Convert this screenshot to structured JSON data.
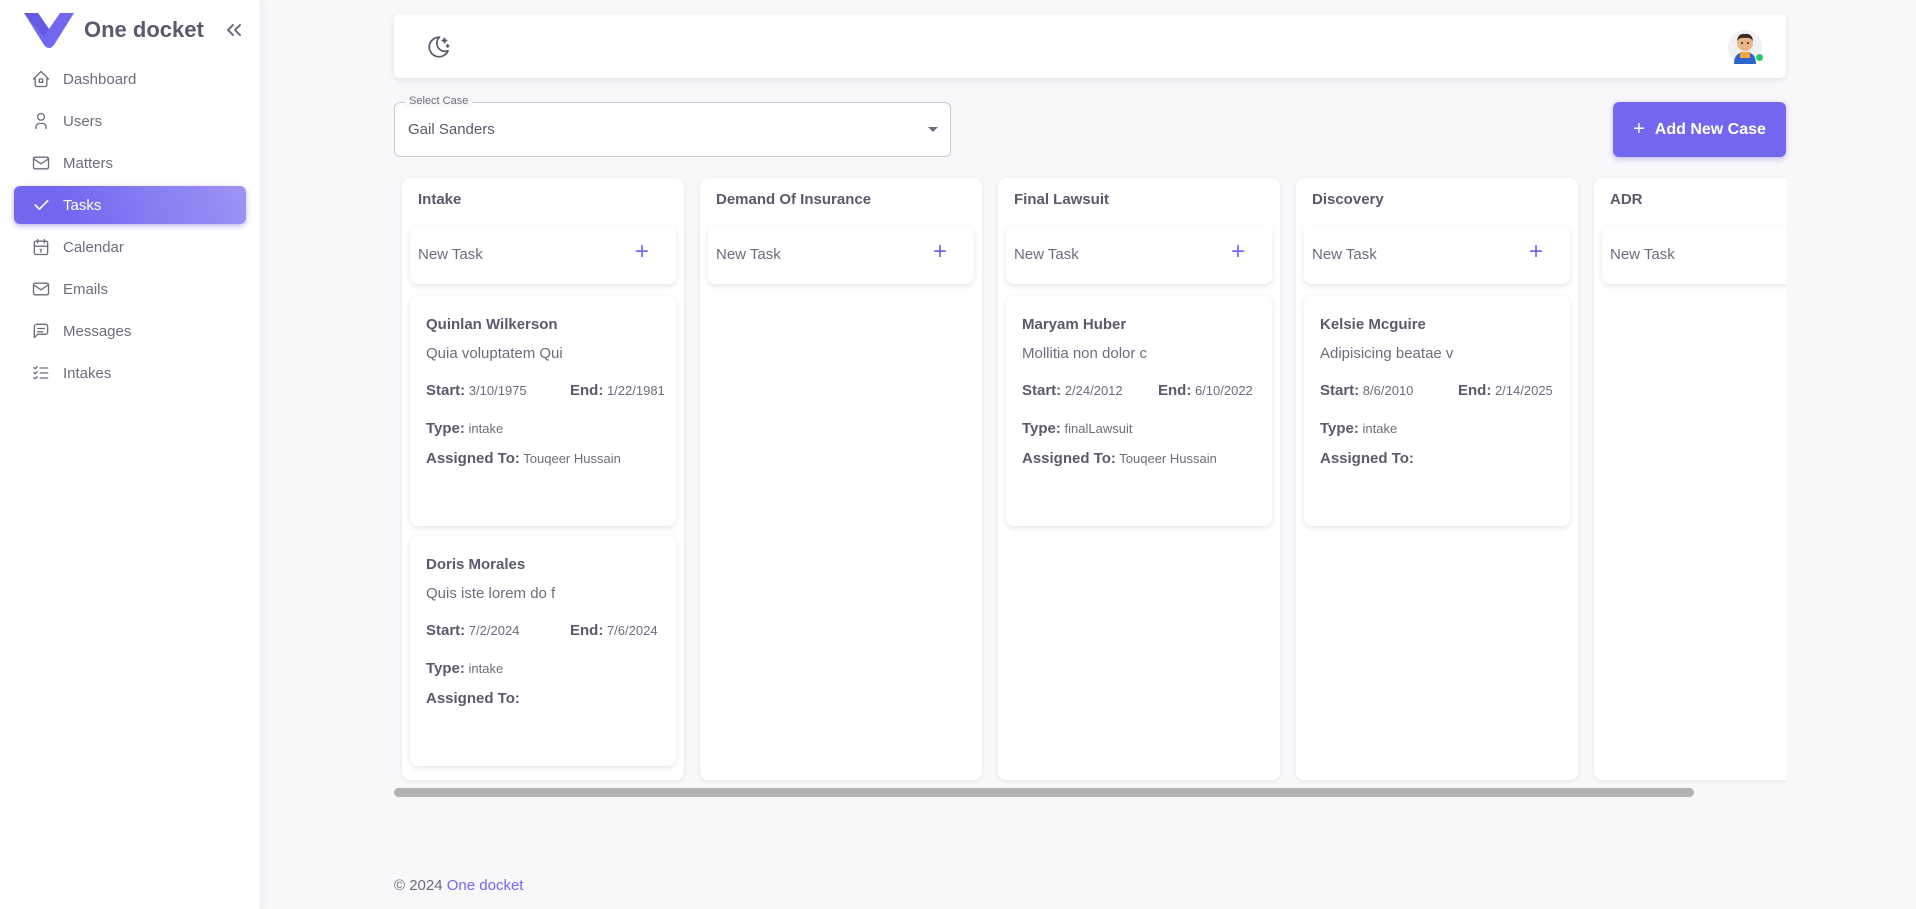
{
  "brand": {
    "name": "One docket",
    "color": "#7367f0"
  },
  "sidebar": {
    "items": [
      {
        "label": "Dashboard",
        "icon": "home-icon",
        "active": false
      },
      {
        "label": "Users",
        "icon": "user-icon",
        "active": false
      },
      {
        "label": "Matters",
        "icon": "mail-icon",
        "active": false
      },
      {
        "label": "Tasks",
        "icon": "check-icon",
        "active": true
      },
      {
        "label": "Calendar",
        "icon": "calendar-icon",
        "active": false
      },
      {
        "label": "Emails",
        "icon": "mail-icon",
        "active": false
      },
      {
        "label": "Messages",
        "icon": "message-icon",
        "active": false
      },
      {
        "label": "Intakes",
        "icon": "list-check-icon",
        "active": false
      }
    ]
  },
  "select_case": {
    "label": "Select Case",
    "value": "Gail Sanders"
  },
  "add_case_button": {
    "label": "Add New Case"
  },
  "new_task_label": "New Task",
  "columns": [
    {
      "title": "Intake",
      "tasks": [
        {
          "name": "Quinlan Wilkerson",
          "desc": "Quia voluptatem Qui",
          "start": "3/10/1975",
          "end": "1/22/1981",
          "type": "intake",
          "assigned": "Touqeer Hussain"
        },
        {
          "name": "Doris Morales",
          "desc": "Quis iste lorem do f",
          "start": "7/2/2024",
          "end": "7/6/2024",
          "type": "intake",
          "assigned": ""
        }
      ]
    },
    {
      "title": "Demand Of Insurance",
      "tasks": []
    },
    {
      "title": "Final Lawsuit",
      "tasks": [
        {
          "name": "Maryam Huber",
          "desc": "Mollitia non dolor c",
          "start": "2/24/2012",
          "end": "6/10/2022",
          "type": "finalLawsuit",
          "assigned": "Touqeer Hussain"
        }
      ]
    },
    {
      "title": "Discovery",
      "tasks": [
        {
          "name": "Kelsie Mcguire",
          "desc": "Adipisicing beatae v",
          "start": "8/6/2010",
          "end": "2/14/2025",
          "type": "intake",
          "assigned": ""
        }
      ]
    },
    {
      "title": "ADR",
      "tasks": []
    }
  ],
  "task_labels": {
    "start": "Start:",
    "end": "End:",
    "type": "Type:",
    "assigned": "Assigned To:"
  },
  "footer": {
    "copyright": "© 2024 ",
    "link": "One docket"
  }
}
